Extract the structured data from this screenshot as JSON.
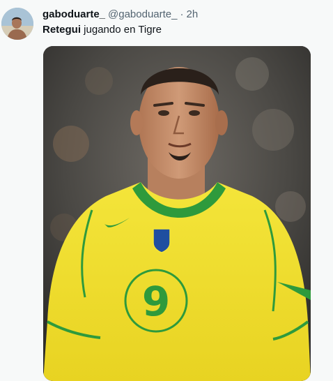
{
  "tweet": {
    "author": {
      "display_name": "gaboduarte_",
      "handle": "@gaboduarte_",
      "avatar_icon": "user-avatar-photo"
    },
    "separator": "·",
    "time": "2h",
    "text": {
      "mention": "Retegui",
      "body": " jugando en Tigre"
    },
    "media": {
      "type": "photo",
      "jersey_number": "9"
    }
  },
  "colors": {
    "name": "#0f1419",
    "meta": "#536471",
    "background": "#f7f9f9",
    "jersey_yellow": "#f2e233",
    "jersey_green": "#2e9a3c"
  }
}
